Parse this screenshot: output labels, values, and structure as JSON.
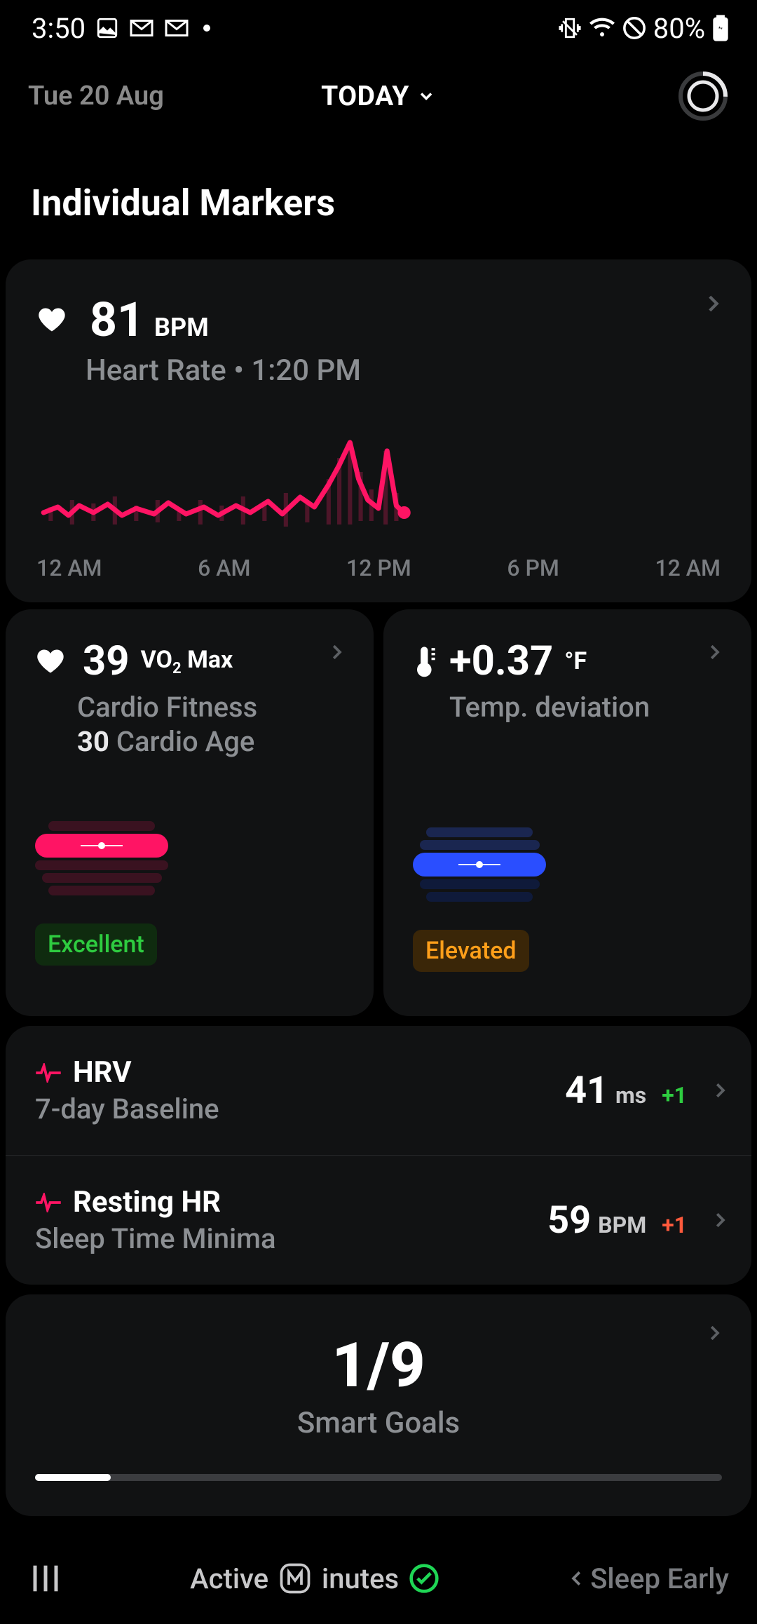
{
  "statusbar": {
    "time": "3:50",
    "battery": "80%"
  },
  "header": {
    "date": "Tue 20 Aug",
    "today": "TODAY"
  },
  "sectionTitle": "Individual Markers",
  "heartRate": {
    "value": "81",
    "unit": "BPM",
    "label": "Heart Rate",
    "time": "1:20 PM",
    "axis": [
      "12 AM",
      "6 AM",
      "12 PM",
      "6 PM",
      "12 AM"
    ]
  },
  "cardio": {
    "value": "39",
    "unitPrefix": "VO",
    "unitSub": "2",
    "unitSuffix": " Max",
    "label": "Cardio Fitness",
    "ageVal": "30",
    "ageLabel": "Cardio Age",
    "badge": "Excellent"
  },
  "temp": {
    "value": "+0.37",
    "unit": "°F",
    "label": "Temp. deviation",
    "badge": "Elevated"
  },
  "hrv": {
    "title": "HRV",
    "sub": "7-day Baseline",
    "value": "41",
    "unit": "ms",
    "delta": "+1"
  },
  "resting": {
    "title": "Resting HR",
    "sub": "Sleep Time Minima",
    "value": "59",
    "unit": "BPM",
    "delta": "+1"
  },
  "goals": {
    "value": "1/9",
    "label": "Smart Goals",
    "progressPct": 11
  },
  "bottom": {
    "center": "Active Minutes",
    "right": "Sleep Early"
  },
  "chart_data": {
    "type": "line",
    "title": "Heart Rate",
    "xlabel": "",
    "ylabel": "BPM",
    "x_ticks": [
      "12 AM",
      "6 AM",
      "12 PM",
      "6 PM",
      "12 AM"
    ],
    "ylim": [
      50,
      130
    ],
    "x": [
      0,
      1,
      2,
      3,
      4,
      5,
      6,
      7,
      8,
      9,
      10,
      11,
      12,
      12.5,
      13,
      13.3
    ],
    "values": [
      74,
      72,
      78,
      70,
      72,
      75,
      68,
      78,
      72,
      80,
      74,
      90,
      116,
      80,
      118,
      74
    ],
    "note": "Values estimated from chart pixels; data ends ~1:20 PM"
  }
}
